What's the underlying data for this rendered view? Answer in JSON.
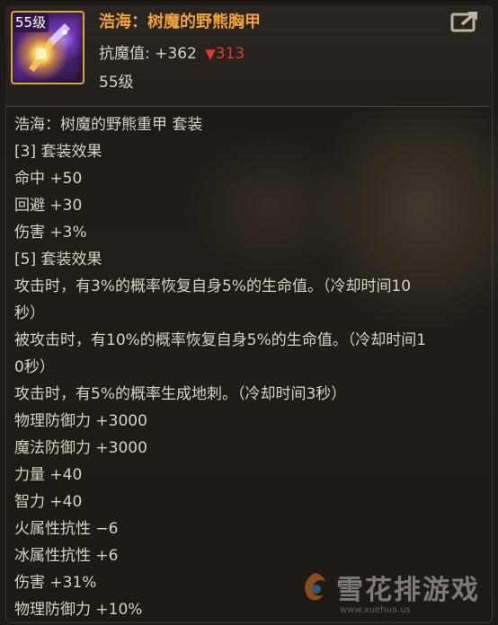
{
  "item": {
    "level_badge": "55级",
    "name": "浩海：树魔的野熊胸甲",
    "stat_label": "抗魔值:",
    "stat_value": "+362",
    "stat_down_arrow": "▼",
    "stat_down_value": "313",
    "required_level": "55级",
    "icon": "armor-item-icon"
  },
  "share_button": {
    "icon": "share-icon"
  },
  "description_lines": [
    "浩海：树魔的野熊重甲 套装",
    "[3] 套装效果",
    "命中 +50",
    "回避 +30",
    "伤害 +3%",
    "[5] 套装效果",
    "攻击时，有3%的概率恢复自身5%的生命值。（冷却时间10",
    "秒）",
    "被攻击时，有10%的概率恢复自身5%的生命值。（冷却时间1",
    "0秒）",
    "攻击时，有5%的概率生成地刺。（冷却时间3秒）",
    "物理防御力 +3000",
    "魔法防御力 +3000",
    "力量 +40",
    "智力 +40",
    "火属性抗性 −6",
    "冰属性抗性 +6",
    "伤害 +31%",
    "物理防御力 +10%"
  ],
  "watermark": {
    "text": "雪花排游戏",
    "url": "www.xuehua.us"
  },
  "colors": {
    "item_name": "#f2a23a",
    "stat_down": "#e23b2e",
    "body_text": "#d8d2c2",
    "icon_border": "#d7a93a",
    "background": "#191512"
  }
}
